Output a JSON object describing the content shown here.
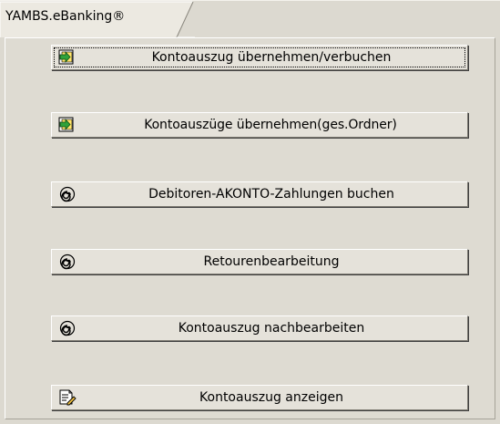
{
  "tab": {
    "label": "YAMBS.eBanking®"
  },
  "buttons": [
    {
      "label": "Kontoauszug übernehmen/verbuchen",
      "icon": "import-arrow-icon"
    },
    {
      "label": "Kontoauszüge übernehmen(ges.Ordner)",
      "icon": "import-arrow-icon"
    },
    {
      "label": "Debitoren-AKONTO-Zahlungen buchen",
      "icon": "spiral-icon"
    },
    {
      "label": "Retourenbearbeitung",
      "icon": "spiral-icon"
    },
    {
      "label": "Kontoauszug nachbearbeiten",
      "icon": "spiral-icon"
    },
    {
      "label": "Kontoauszug anzeigen",
      "icon": "document-display-icon"
    }
  ],
  "colors": {
    "import_icon_green": "#2fa23a",
    "spiral_icon": "#000000"
  }
}
